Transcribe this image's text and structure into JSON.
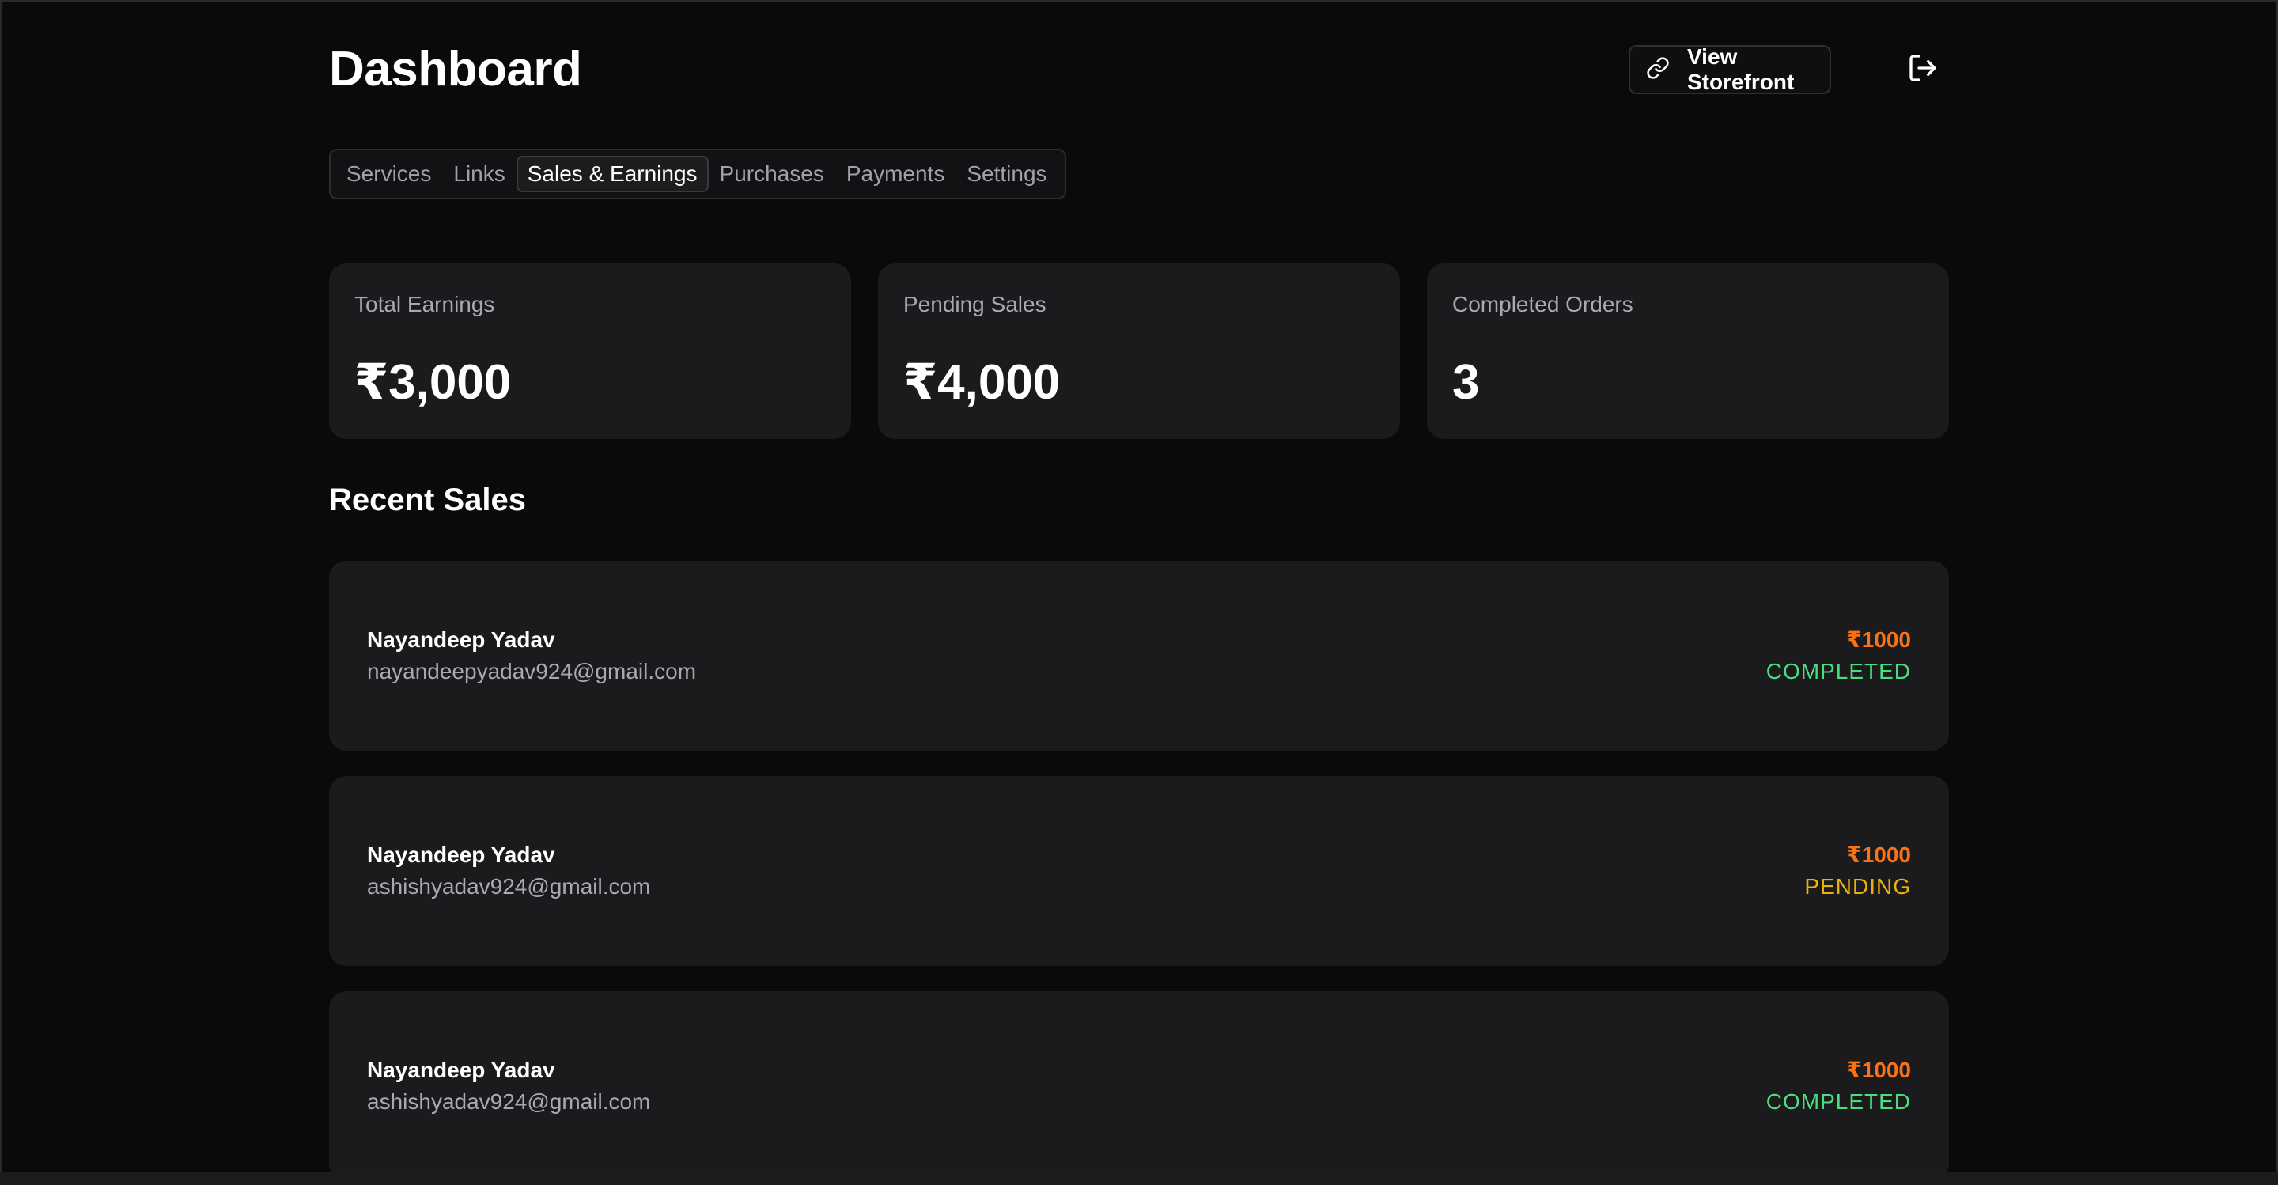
{
  "header": {
    "title": "Dashboard",
    "storefront_label": "View Storefront",
    "storefront_icon": "link-icon",
    "logout_icon": "logout-icon"
  },
  "tabs": [
    {
      "label": "Services",
      "active": false
    },
    {
      "label": "Links",
      "active": false
    },
    {
      "label": "Sales & Earnings",
      "active": true
    },
    {
      "label": "Purchases",
      "active": false
    },
    {
      "label": "Payments",
      "active": false
    },
    {
      "label": "Settings",
      "active": false
    }
  ],
  "stats": [
    {
      "label": "Total Earnings",
      "value": "₹3,000"
    },
    {
      "label": "Pending Sales",
      "value": "₹4,000"
    },
    {
      "label": "Completed Orders",
      "value": "3"
    }
  ],
  "recent_sales": {
    "title": "Recent Sales",
    "items": [
      {
        "name": "Nayandeep Yadav",
        "email": "nayandeepyadav924@gmail.com",
        "amount": "₹1000",
        "status": "COMPLETED"
      },
      {
        "name": "Nayandeep Yadav",
        "email": "ashishyadav924@gmail.com",
        "amount": "₹1000",
        "status": "PENDING"
      },
      {
        "name": "Nayandeep Yadav",
        "email": "ashishyadav924@gmail.com",
        "amount": "₹1000",
        "status": "COMPLETED"
      }
    ]
  },
  "colors": {
    "background": "#0a0a0b",
    "card": "#1b1b1d",
    "amount": "#f97316",
    "completed": "#4ade80",
    "pending": "#eab308"
  }
}
